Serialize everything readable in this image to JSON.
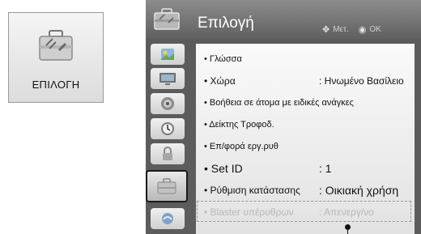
{
  "tile": {
    "label": "ΕΠΙΛΟΓΗ",
    "icon": "toolbox-icon"
  },
  "header": {
    "title": "Επιλογή",
    "hint_move": "Μετ.",
    "hint_ok": "OK",
    "icon": "toolbox-icon"
  },
  "sidebar": {
    "items": [
      {
        "icon": "picture-icon"
      },
      {
        "icon": "screen-icon"
      },
      {
        "icon": "speaker-icon"
      },
      {
        "icon": "clock-icon"
      },
      {
        "icon": "lock-icon"
      },
      {
        "icon": "toolbox-icon",
        "selected": true
      },
      {
        "icon": "usb-icon"
      }
    ]
  },
  "menu": {
    "items": [
      {
        "label": "• Γλώσσα",
        "value": ""
      },
      {
        "label": "• Χώρα",
        "value": ": Ηνωμένο Βασίλειο"
      },
      {
        "label": "• Βοήθεια σε άτομα με ειδικές ανάγκες",
        "value": ""
      },
      {
        "label": "• Δείκτης Τροφοδ.",
        "value": ""
      },
      {
        "label": "• Επ/φορά εργ.ρυθ",
        "value": ""
      },
      {
        "label": "• Set ID",
        "value": ": 1"
      },
      {
        "label": "• Ρύθμιση κατάστασης",
        "value": ": Οικιακή χρήση"
      },
      {
        "label": "• Blaster υπέρυθρων",
        "value": ": Απενεργ/νο"
      }
    ]
  },
  "colors": {
    "panel_bg": "#5c5c5c",
    "dim_text": "#b8b8b8"
  }
}
